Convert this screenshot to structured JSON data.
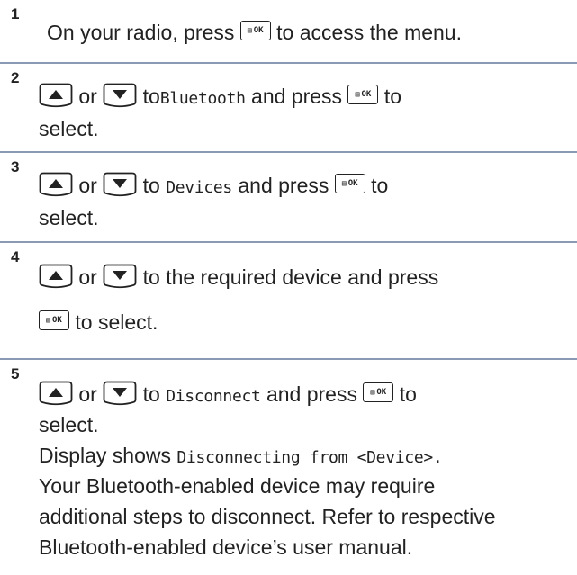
{
  "steps": [
    {
      "num": "1",
      "a": "On your radio, press",
      "b": "to access the menu."
    },
    {
      "num": "2",
      "or": "or",
      "to": "to",
      "item": "Bluetooth",
      "press": "and press",
      "to2": "to",
      "cont": "select."
    },
    {
      "num": "3",
      "or": "or",
      "to": "to",
      "item": "Devices",
      "press": "and press",
      "to2": "to",
      "cont": "select."
    },
    {
      "num": "4",
      "or": "or",
      "rest": "to the required device and press",
      "cont": "to select."
    },
    {
      "num": "5",
      "or": "or",
      "to": "to",
      "item": "Disconnect",
      "press": "and press",
      "to2": "to",
      "cont": "select.",
      "l3a": "Display shows",
      "l3b": "Disconnecting from <Device>.",
      "l4": "Your Bluetooth-enabled device may require",
      "l5": "additional steps to disconnect. Refer to respective",
      "l6": "Bluetooth-enabled device’s user manual."
    }
  ],
  "icons": {
    "ok_glyph": "▤",
    "ok_label": "OK"
  }
}
